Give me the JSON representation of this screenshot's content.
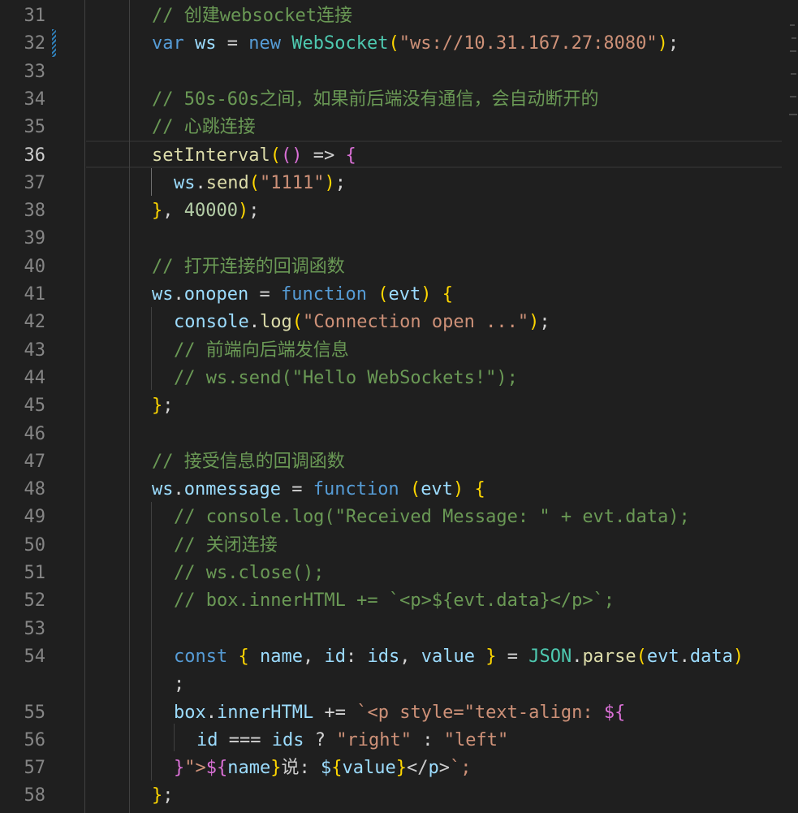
{
  "editor": {
    "language": "javascript",
    "active_line": "36",
    "lines": [
      {
        "num": "31",
        "text": "// 创建websocket连接"
      },
      {
        "num": "32",
        "text": "var ws = new WebSocket(\"ws://10.31.167.27:8080\");"
      },
      {
        "num": "33",
        "text": ""
      },
      {
        "num": "34",
        "text": "// 50s-60s之间，如果前后端没有通信，会自动断开的"
      },
      {
        "num": "35",
        "text": "// 心跳连接"
      },
      {
        "num": "36",
        "text": "setInterval(() => {"
      },
      {
        "num": "37",
        "text": "ws.send(\"1111\");"
      },
      {
        "num": "38",
        "text": "}, 40000);"
      },
      {
        "num": "39",
        "text": ""
      },
      {
        "num": "40",
        "text": "// 打开连接的回调函数"
      },
      {
        "num": "41",
        "text": "ws.onopen = function (evt) {"
      },
      {
        "num": "42",
        "text": "console.log(\"Connection open ...\");"
      },
      {
        "num": "43",
        "text": "// 前端向后端发信息"
      },
      {
        "num": "44",
        "text": "// ws.send(\"Hello WebSockets!\");"
      },
      {
        "num": "45",
        "text": "};"
      },
      {
        "num": "46",
        "text": ""
      },
      {
        "num": "47",
        "text": "// 接受信息的回调函数"
      },
      {
        "num": "48",
        "text": "ws.onmessage = function (evt) {"
      },
      {
        "num": "49",
        "text": "// console.log(\"Received Message: \" + evt.data);"
      },
      {
        "num": "50",
        "text": "// 关闭连接"
      },
      {
        "num": "51",
        "text": "// ws.close();"
      },
      {
        "num": "52",
        "text": "// box.innerHTML += `<p>${evt.data}</p>`;"
      },
      {
        "num": "53",
        "text": ""
      },
      {
        "num": "54",
        "text": "const { name, id: ids, value } = JSON.parse(evt.data)"
      },
      {
        "num": "",
        "text": ";"
      },
      {
        "num": "55",
        "text": "box.innerHTML += `<p style=\"text-align: ${"
      },
      {
        "num": "56",
        "text": "id === ids ? \"right\" : \"left\""
      },
      {
        "num": "57",
        "text": "}\">${name}说: ${value}</p>`;"
      },
      {
        "num": "58",
        "text": "};"
      }
    ]
  },
  "colors": {
    "background": "#1f1f1f",
    "comment": "#6a9955",
    "keyword": "#569cd6",
    "variable": "#9cdcfe",
    "function": "#dcdcaa",
    "class": "#4ec9b0",
    "string": "#ce9178",
    "number": "#b5cea8",
    "bracket_level1": "#ffd700",
    "bracket_level2": "#da70d6",
    "bracket_level3": "#179fff"
  }
}
